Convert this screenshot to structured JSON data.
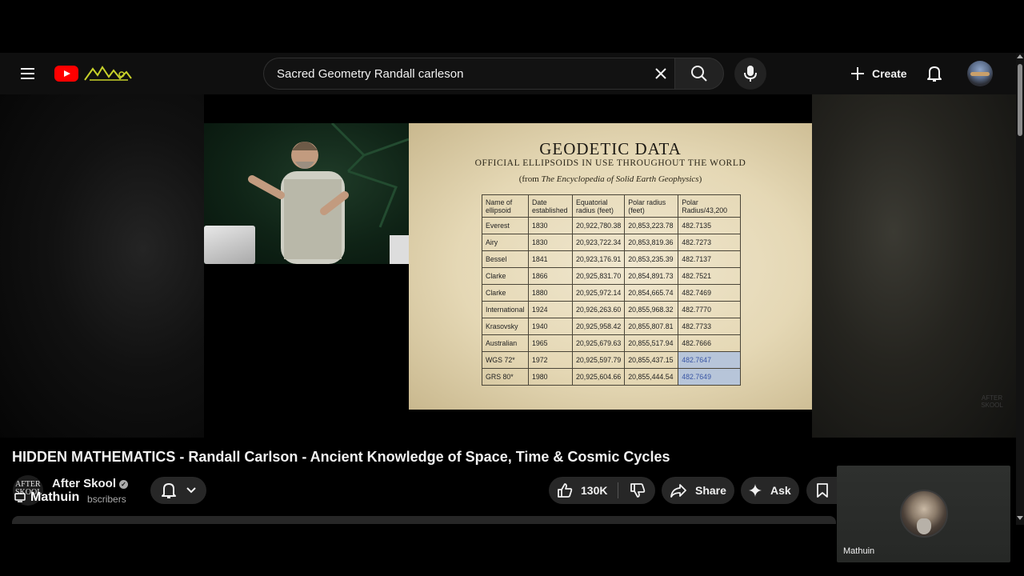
{
  "header": {
    "search_value": "Sacred Geometry Randall carleson",
    "create_label": "Create",
    "icons": [
      "menu-icon",
      "youtube-logo-icon",
      "close-icon",
      "search-icon",
      "mic-icon",
      "plus-icon",
      "bell-icon"
    ]
  },
  "slide": {
    "title": "GEODETIC DATA",
    "subtitle": "OFFICIAL ELLIPSOIDS IN USE THROUGHOUT THE WORLD",
    "source_prefix": "(from ",
    "source_title": "The Encyclopedia of Solid Earth Geophysics",
    "source_suffix": ")",
    "headers": [
      "Name of ellipsoid",
      "Date established",
      "Equatorial radius (feet)",
      "Polar radius (feet)",
      "Polar Radius/43,200"
    ],
    "rows": [
      [
        "Everest",
        "1830",
        "20,922,780.38",
        "20,853,223.78",
        "482.7135"
      ],
      [
        "Airy",
        "1830",
        "20,923,722.34",
        "20,853,819.36",
        "482.7273"
      ],
      [
        "Bessel",
        "1841",
        "20,923,176.91",
        "20,853,235.39",
        "482.7137"
      ],
      [
        "Clarke",
        "1866",
        "20,925,831.70",
        "20,854,891.73",
        "482.7521"
      ],
      [
        "Clarke",
        "1880",
        "20,925,972.14",
        "20,854,665.74",
        "482.7469"
      ],
      [
        "International",
        "1924",
        "20,926,263.60",
        "20,855,968.32",
        "482.7770"
      ],
      [
        "Krasovsky",
        "1940",
        "20,925,958.42",
        "20,855,807.81",
        "482.7733"
      ],
      [
        "Australian",
        "1965",
        "20,925,679.63",
        "20,855,517.94",
        "482.7666"
      ],
      [
        "WGS 72*",
        "1972",
        "20,925,597.79",
        "20,855,437.15",
        "482.7647"
      ],
      [
        "GRS 80*",
        "1980",
        "20,925,604.66",
        "20,855,444.54",
        "482.7649"
      ]
    ]
  },
  "video": {
    "title": "HIDDEN MATHEMATICS - Randall Carlson - Ancient Knowledge of Space, Time & Cosmic Cycles",
    "channel_name": "After Skool",
    "channel_avatar_text": "AFTER SKOOL",
    "subscribers_label": "bscribers",
    "cast_name": "Mathuin",
    "likes": "130K",
    "share_label": "Share",
    "ask_label": "Ask"
  },
  "webcam": {
    "name": "Mathuin"
  },
  "colors": {
    "accent": "#ff0000",
    "highlight_cell": "#b7c5d9",
    "button_bg": "#272727"
  }
}
